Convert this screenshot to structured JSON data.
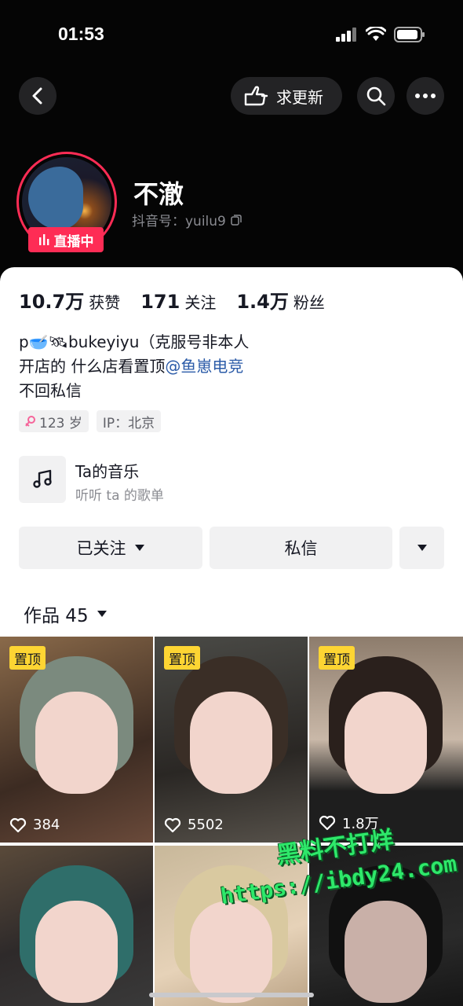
{
  "status_bar": {
    "time": "01:53"
  },
  "nav": {
    "request_update_label": "求更新"
  },
  "profile": {
    "live_badge": "直播中",
    "name": "不澈",
    "douyin_id": "抖音号：yuilu9"
  },
  "stats": [
    {
      "value": "10.7万",
      "label": "获赞"
    },
    {
      "value": "171",
      "label": "关注"
    },
    {
      "value": "1.4万",
      "label": "粉丝"
    }
  ],
  "bio": {
    "line1": "p🥣🛰bukeyiyu（克服号非本人",
    "line2_prefix": "开店的 什么店看置顶",
    "line2_mention": "@鱼崽电竞",
    "line3": "不回私信"
  },
  "tags": {
    "age": "123 岁",
    "ip": "IP：北京"
  },
  "music": {
    "title": "Ta的音乐",
    "subtitle": "听听 ta 的歌单"
  },
  "actions": {
    "follow_label": "已关注",
    "message_label": "私信"
  },
  "works": {
    "tab_label": "作品 45"
  },
  "grid": [
    {
      "pinned": "置顶",
      "likes": "384"
    },
    {
      "pinned": "置顶",
      "likes": "5502"
    },
    {
      "pinned": "置顶",
      "likes": "1.8万"
    },
    {
      "pinned": "",
      "likes": ""
    },
    {
      "pinned": "",
      "likes": ""
    },
    {
      "pinned": "",
      "likes": ""
    }
  ],
  "watermark": {
    "line1": "黑料不打烊",
    "line2": "https://ibdy24.com"
  },
  "colors": {
    "accent": "#fe2c55",
    "pin": "#fdd533",
    "mention": "#2b5ba8"
  }
}
